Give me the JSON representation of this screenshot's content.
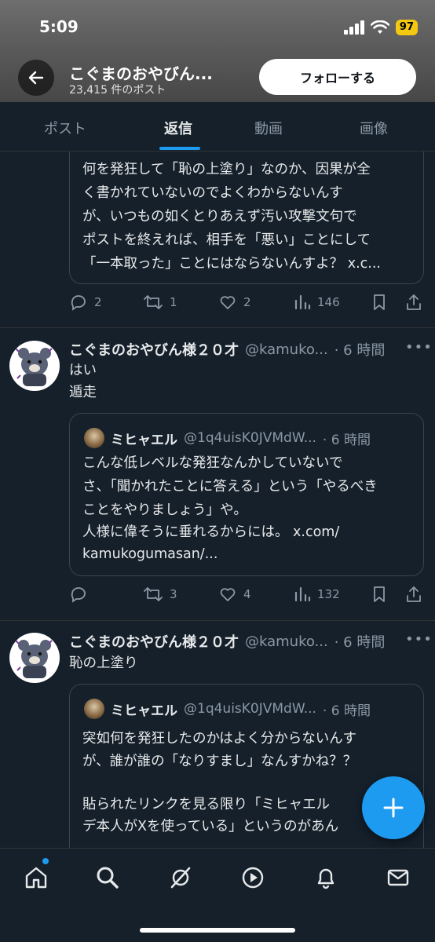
{
  "status_bar": {
    "time": "5:09",
    "battery": "97"
  },
  "profile_header": {
    "name": "こぐまのおやびん...",
    "post_count": "23,415 件のポスト",
    "follow_label": "フォローする"
  },
  "tabs": [
    {
      "label": "ポスト"
    },
    {
      "label": "返信"
    },
    {
      "label": "動画"
    },
    {
      "label": "画像"
    }
  ],
  "active_tab": "返信",
  "top_partial": {
    "quote_lines": [
      "何を発狂して「恥の上塗り」なのか、因果が全",
      "く書かれていないのでよくわからないんす",
      "が、いつもの如くとりあえず汚い攻撃文句で",
      "ポストを終えれば、相手を「悪い」ことにして",
      "「一本取った」ことにはならないんすよ？ x.c..."
    ],
    "stats": {
      "replies": "2",
      "reposts": "1",
      "likes": "2",
      "views": "146"
    }
  },
  "posts": [
    {
      "name": "こぐまのおやびん様２０才",
      "handle": "@kamuko...",
      "time": "· 6 時間",
      "more": "•••",
      "text_lines": [
        "はい",
        "遁走"
      ],
      "quote": {
        "name": "ミヒャエル",
        "handle": "@1q4uisK0JVMdW...",
        "time": "· 6 時間",
        "lines": [
          "こんな低レベルな発狂なんかしていないで",
          "さ、「聞かれたことに答える」という「やるべき",
          "ことをやりましょう」や。",
          "人様に偉そうに垂れるからには。 x.com/",
          "kamukogumasan/..."
        ]
      },
      "stats": {
        "replies": "",
        "reposts": "3",
        "likes": "4",
        "views": "132"
      }
    },
    {
      "name": "こぐまのおやびん様２０才",
      "handle": "@kamuko...",
      "time": "· 6 時間",
      "more": "•••",
      "text_lines": [
        "恥の上塗り"
      ],
      "quote": {
        "name": "ミヒャエル",
        "handle": "@1q4uisK0JVMdW...",
        "time": "· 6 時間",
        "lines": [
          "突如何を発狂したのかはよく分からないんす",
          "が、誰が誰の「なりすまし」なんすかね？？",
          "",
          "貼られたリンクを見る限り「ミヒャエル",
          "デ本人がXを使っている」というのがあん"
        ]
      }
    }
  ],
  "colors": {
    "accent": "#1d9bf0",
    "background": "#15202b",
    "muted": "#8b98a5",
    "text": "#e7e9ea"
  },
  "icons": {
    "status": [
      "signal-icon",
      "wifi-icon",
      "battery-icon"
    ],
    "actions": [
      "reply-icon",
      "repost-icon",
      "like-icon",
      "views-icon",
      "bookmark-icon",
      "share-icon"
    ],
    "nav": [
      "home-icon",
      "search-icon",
      "grok-icon",
      "spaces-icon",
      "notifications-icon",
      "messages-icon"
    ],
    "fab": "plus-icon"
  }
}
